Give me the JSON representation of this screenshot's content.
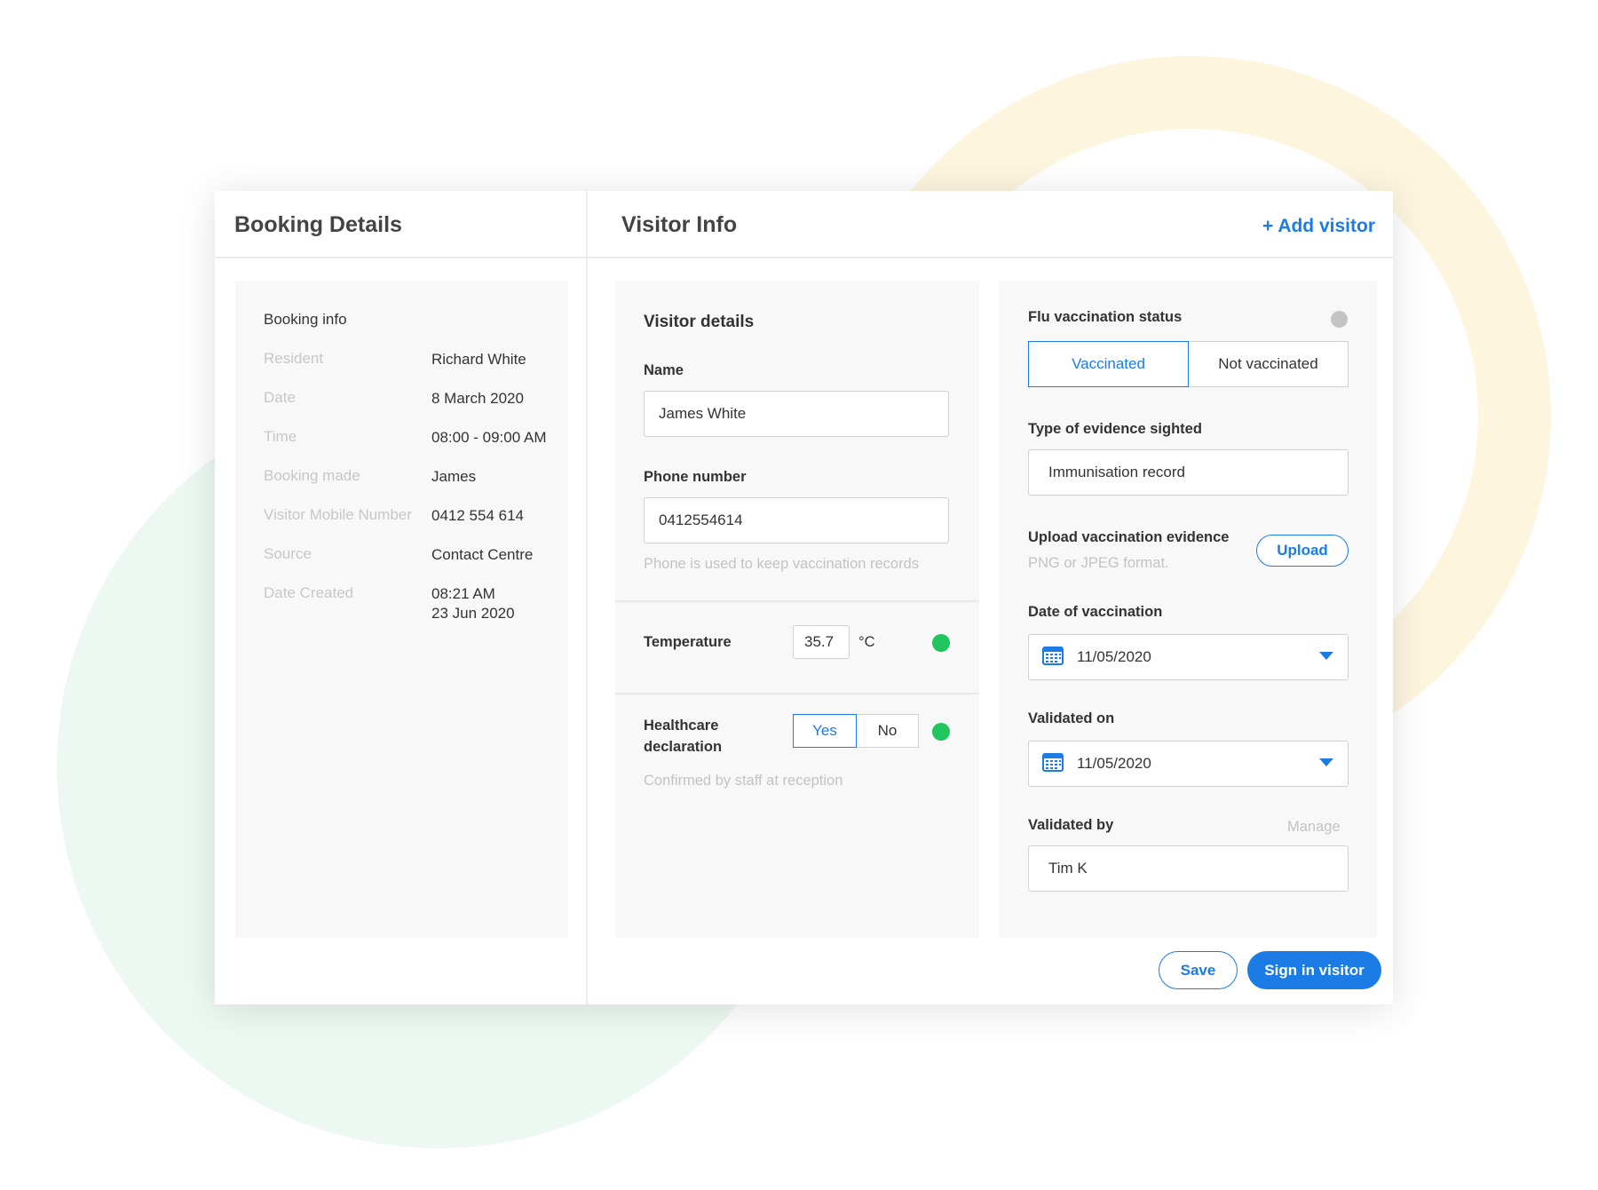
{
  "booking": {
    "title": "Booking Details",
    "section_title": "Booking info",
    "rows": [
      {
        "label": "Resident",
        "value": "Richard White"
      },
      {
        "label": "Date",
        "value": "8 March 2020"
      },
      {
        "label": "Time",
        "value": "08:00 - 09:00 AM"
      },
      {
        "label": "Booking made",
        "value": "James"
      },
      {
        "label": "Visitor Mobile Number",
        "value": "0412 554 614"
      },
      {
        "label": "Source",
        "value": "Contact Centre"
      },
      {
        "label": "Date Created",
        "value": "08:21 AM",
        "value2": "23 Jun 2020"
      }
    ]
  },
  "visitor": {
    "title": "Visitor Info",
    "add_label": "+ Add visitor",
    "details": {
      "title": "Visitor details",
      "name_label": "Name",
      "name_value": "James White",
      "phone_label": "Phone number",
      "phone_value": "0412554614",
      "phone_hint": "Phone is used to keep vaccination records"
    },
    "temperature": {
      "label": "Temperature",
      "value": "35.7",
      "unit": "°C",
      "status_color": "#21c55d"
    },
    "healthcare": {
      "label_line1": "Healthcare",
      "label_line2": "declaration",
      "yes": "Yes",
      "no": "No",
      "selected": "Yes",
      "hint": "Confirmed by staff at reception",
      "status_color": "#21c55d"
    },
    "flu": {
      "status_label": "Flu vaccination status",
      "vaccinated": "Vaccinated",
      "not_vaccinated": "Not vaccinated",
      "selected": "Vaccinated",
      "status_color": "#c4c4c4",
      "evidence_label": "Type of evidence sighted",
      "evidence_value": "Immunisation record",
      "upload_label": "Upload vaccination evidence",
      "upload_hint": "PNG or JPEG format.",
      "upload_button": "Upload",
      "date_label": "Date of vaccination",
      "date_value": "11/05/2020",
      "validated_on_label": "Validated on",
      "validated_on_value": "11/05/2020",
      "validated_by_label": "Validated by",
      "manage_label": "Manage",
      "validated_by_value": "Tim K"
    },
    "actions": {
      "save": "Save",
      "sign_in": "Sign in visitor"
    }
  },
  "colors": {
    "accent": "#1a7ce4",
    "ok": "#21c55d",
    "ring": "#fdf5de",
    "mint": "#eef8f3"
  },
  "icons": [
    "calendar-icon",
    "chevron-down-icon",
    "status-dot"
  ]
}
